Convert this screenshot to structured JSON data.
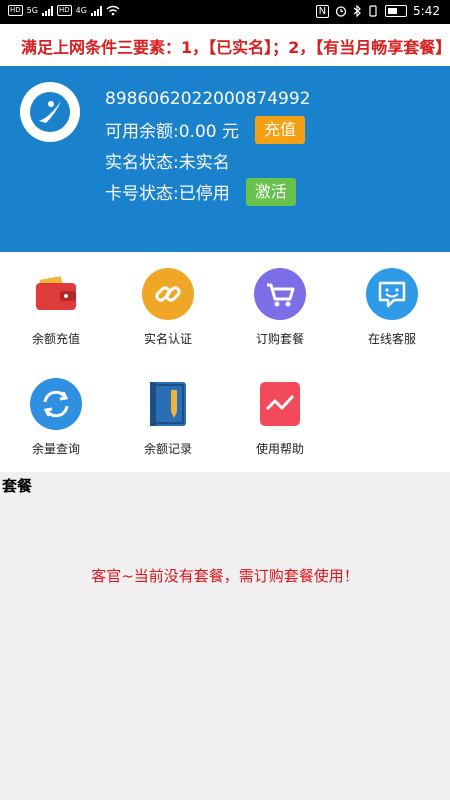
{
  "status_bar": {
    "left_tags": [
      "HD",
      "5G",
      "4G"
    ],
    "time": "5:42"
  },
  "notice": {
    "text": "满足上网条件三要素：1，【已实名】；2，【有当月畅享套餐】"
  },
  "card": {
    "number": "8986062022000874992",
    "balance_text": "可用余额:0.00 元",
    "recharge_label": "充值",
    "realname_text": "实名状态:未实名",
    "card_status_text": "卡号状态:已停用",
    "activate_label": "激活"
  },
  "menu": {
    "items": [
      {
        "label": "余额充值",
        "icon": "wallet-icon"
      },
      {
        "label": "实名认证",
        "icon": "link-icon"
      },
      {
        "label": "订购套餐",
        "icon": "cart-icon"
      },
      {
        "label": "在线客服",
        "icon": "chat-icon"
      },
      {
        "label": "余量查询",
        "icon": "refresh-icon"
      },
      {
        "label": "余额记录",
        "icon": "notebook-icon"
      },
      {
        "label": "使用帮助",
        "icon": "trend-icon"
      }
    ]
  },
  "package": {
    "title": "套餐",
    "empty_message": "客官~当前没有套餐，需订购套餐使用！"
  },
  "colors": {
    "header_blue": "#1a82cc",
    "notice_red": "#d81e1e",
    "orange": "#f3a012",
    "green": "#69c24c"
  }
}
